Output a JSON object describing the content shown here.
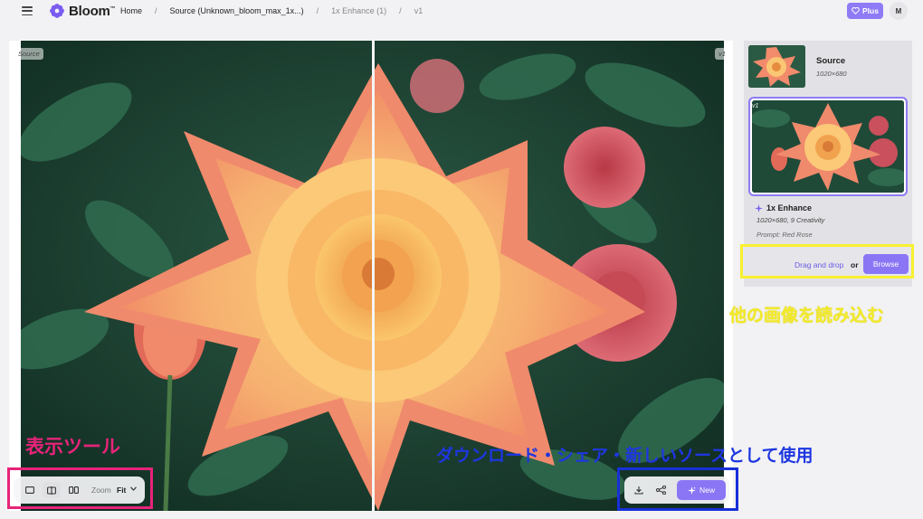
{
  "header": {
    "app_name": "Bloom",
    "app_name_mark": "™",
    "breadcrumb": {
      "home": "Home",
      "source": "Source (Unknown_bloom_max_1x...)",
      "enhance": "1x Enhance (1)",
      "version": "v1",
      "separator": "/"
    },
    "plus_label": "Plus",
    "avatar_initial": "M"
  },
  "canvas": {
    "left_tag": "Source",
    "right_tag": "v1"
  },
  "panel": {
    "source": {
      "title": "Source",
      "size": "1020×680"
    },
    "version": {
      "tag": "v1",
      "title": "1x Enhance",
      "meta": "1020×680, 9 Creativity",
      "prompt": "Prompt: Red Rose"
    },
    "drop": {
      "text": "Drag and drop",
      "or": "or",
      "browse": "Browse"
    }
  },
  "view_tools": {
    "zoom_label": "Zoom",
    "zoom_value": "Fit"
  },
  "actions": {
    "new_label": "New"
  },
  "annotations": {
    "view_tools": "表示ツール",
    "load_image": "他の画像を読み込む",
    "actions": "ダウンロード・シェア・新しいソースとして使用"
  },
  "colors": {
    "accent": "#8a76f5",
    "annotation_pink": "#e8237a",
    "annotation_yellow": "#f8f030",
    "annotation_blue": "#1730d8"
  },
  "icons": {
    "menu": "hamburger-icon",
    "logo": "flower-icon",
    "plus": "heart-icon",
    "single_view": "single-view-icon",
    "split_view": "split-view-icon",
    "side_by_side": "side-by-side-icon",
    "download": "download-icon",
    "share": "share-icon",
    "new": "sparkle-icon"
  }
}
